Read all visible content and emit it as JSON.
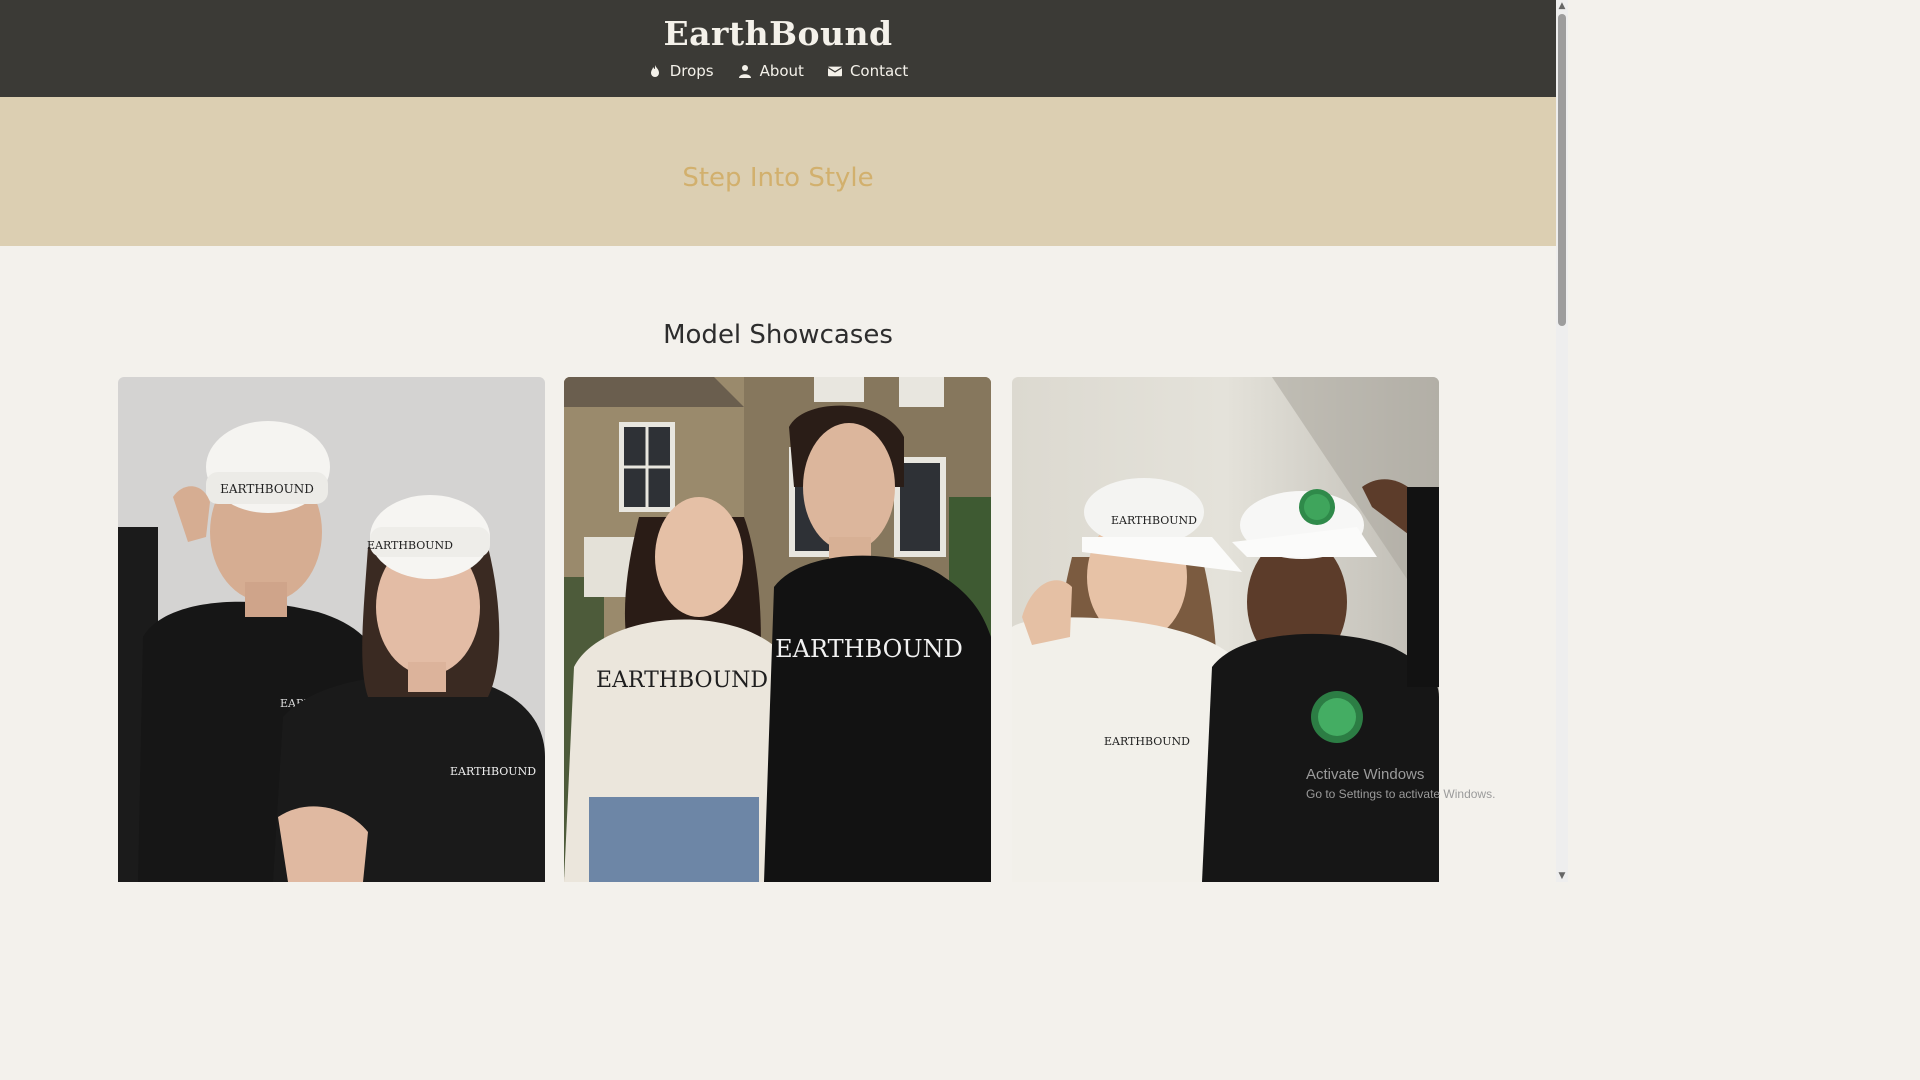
{
  "header": {
    "brand": "EarthBound",
    "nav": [
      {
        "label": "Drops",
        "icon": "fire-icon"
      },
      {
        "label": "About",
        "icon": "user-icon"
      },
      {
        "label": "Contact",
        "icon": "envelope-icon"
      }
    ]
  },
  "hero": {
    "title": "Step Into Style"
  },
  "showcase": {
    "title": "Model Showcases",
    "cards": [
      {
        "brand_text": "EARTHBOUND",
        "scene": "two models in white beanies and black sweatshirts"
      },
      {
        "brand_text": "EARTHBOUND",
        "scene": "two models in branded t-shirts in front of a stone house"
      },
      {
        "brand_text": "EARTHBOUND",
        "scene": "two models in caps and sweatshirts with planet logo"
      }
    ]
  },
  "watermark": {
    "line1": "Activate Windows",
    "line2": "Go to Settings to activate Windows."
  },
  "colors": {
    "header_bg": "#3b3a36",
    "hero_bg": "#dccfb2",
    "hero_text": "#d2b06d",
    "page_bg": "#f3f1ec"
  }
}
